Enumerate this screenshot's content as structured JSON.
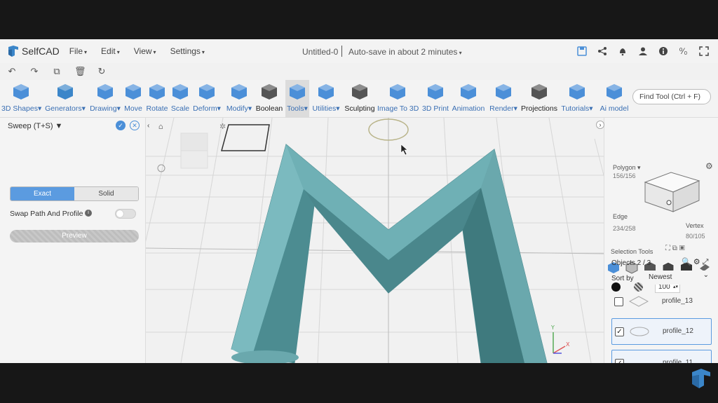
{
  "app": {
    "name": "SelfCAD"
  },
  "menu": [
    "File",
    "Edit",
    "View",
    "Settings"
  ],
  "document": {
    "title": "Untitled-0",
    "autosave": "Auto-save in about 2 minutes"
  },
  "toolbar": [
    {
      "label": "3D Shapes",
      "dropdown": true
    },
    {
      "label": "Generators",
      "dropdown": true
    },
    {
      "label": "Drawing",
      "dropdown": true
    },
    {
      "label": "Move",
      "dropdown": false
    },
    {
      "label": "Rotate",
      "dropdown": false
    },
    {
      "label": "Scale",
      "dropdown": false
    },
    {
      "label": "Deform",
      "dropdown": true
    },
    {
      "label": "Modify",
      "dropdown": true
    },
    {
      "label": "Boolean",
      "dropdown": false
    },
    {
      "label": "Tools",
      "dropdown": true
    },
    {
      "label": "Utilities",
      "dropdown": true
    },
    {
      "label": "Sculpting",
      "dropdown": false
    },
    {
      "label": "Image To 3D",
      "dropdown": false
    },
    {
      "label": "3D Print",
      "dropdown": false
    },
    {
      "label": "Animation",
      "dropdown": false
    },
    {
      "label": "Render",
      "dropdown": true
    },
    {
      "label": "Projections",
      "dropdown": false
    },
    {
      "label": "Tutorials",
      "dropdown": true
    },
    {
      "label": "Ai model",
      "dropdown": false
    }
  ],
  "find_tool": {
    "placeholder": "Find Tool (Ctrl + F)"
  },
  "tool_panel": {
    "title": "Sweep (T+S)",
    "mode_options": [
      "Exact",
      "Solid"
    ],
    "selected_mode": "Exact",
    "swap_label": "Swap Path And Profile",
    "swap_on": false,
    "preview_label": "Preview"
  },
  "right_panel": {
    "polygon_label": "Polygon",
    "polygon_count": "156/156",
    "edge_label": "Edge",
    "edge_count": "234/258",
    "vertex_label": "Vertex",
    "vertex_count": "80/105",
    "selection_tools_label": "Selection Tools",
    "opacity_value": "100",
    "objects_label": "Objects 2 / 3",
    "sort_label": "Sort by",
    "sort_value": "Newest",
    "objects": [
      {
        "name": "profile_13",
        "checked": false,
        "selected": false
      },
      {
        "name": "profile_12",
        "checked": true,
        "selected": true
      },
      {
        "name": "profile_11",
        "checked": true,
        "selected": true
      }
    ]
  },
  "viewport": {
    "model_color": "#5a9ba0",
    "accent": "#4b8fd8"
  }
}
